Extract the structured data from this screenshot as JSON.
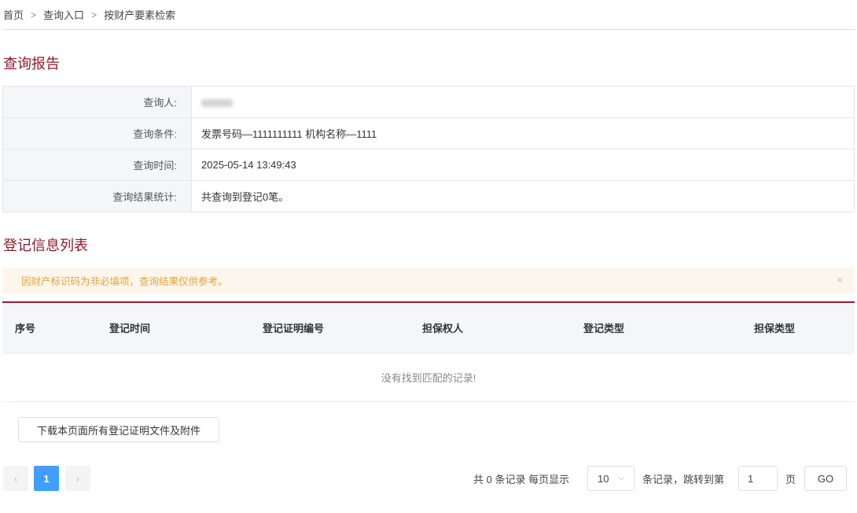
{
  "breadcrumb": {
    "items": [
      "首页",
      "查询入口",
      "按财产要素检索"
    ],
    "separator": ">"
  },
  "report": {
    "title": "查询报告",
    "rows": [
      {
        "label": "查询人:",
        "value": ""
      },
      {
        "label": "查询条件:",
        "value": "发票号码—1111111111 机构名称—1111"
      },
      {
        "label": "查询时间:",
        "value": "2025-05-14 13:49:43"
      },
      {
        "label": "查询结果统计:",
        "value": "共查询到登记0笔。"
      }
    ]
  },
  "registration": {
    "title": "登记信息列表",
    "alert": {
      "text": "因财产标识码为非必填项，查询结果仅供参考。",
      "close": "×"
    },
    "columns": [
      "序号",
      "登记时间",
      "登记证明编号",
      "担保权人",
      "登记类型",
      "担保类型"
    ],
    "empty_text": "没有找到匹配的记录!"
  },
  "download_button": "下载本页面所有登记证明文件及附件",
  "pagination": {
    "prev": "‹",
    "current_page": "1",
    "next": "›",
    "total_prefix": "共 0 条记录 每页显示",
    "page_size": "10",
    "page_size_arrow": "⌵",
    "jump_text": "条记录，跳转到第",
    "jump_value": "1",
    "page_suffix": "页",
    "go": "GO"
  },
  "colors": {
    "accent": "#8c1b2b",
    "active_page": "#409eff",
    "alert_bg": "#fdf6ec",
    "alert_text": "#e6a23c"
  }
}
